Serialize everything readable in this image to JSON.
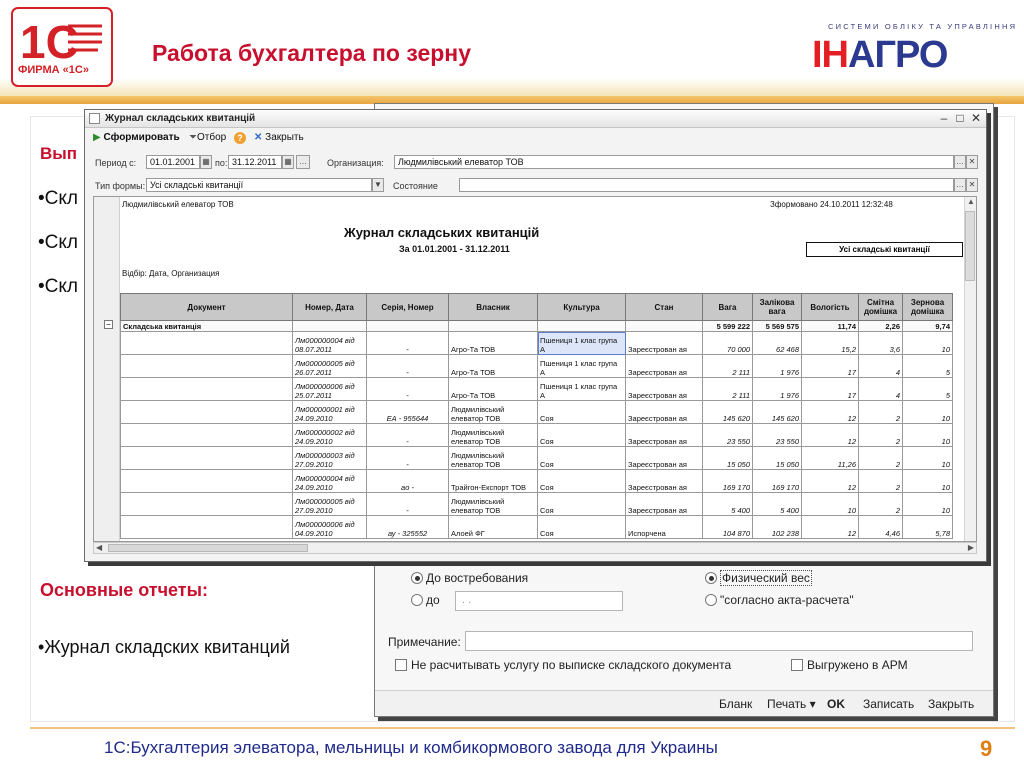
{
  "slide": {
    "title": "Работа бухгалтера по зерну",
    "logo_1c_caption": "ФИРМА «1С»",
    "inagro_tagline": "СИСТЕМИ ОБЛІКУ ТА УПРАВЛІННЯ",
    "inagro_logo_a": "ІН",
    "inagro_logo_b": "АГРО",
    "bullets_partial": [
      "Вып",
      "•Скл",
      "•Скл",
      "•Скл"
    ],
    "reports_heading": "Основные отчеты:",
    "reports_bullet": "•Журнал складских квитанций",
    "footer": "1С:Бухгалтерия элеватора, мельницы и комбикормового завода для Украины",
    "page_number": "9"
  },
  "background_form": {
    "radio_on_demand": "До востребования",
    "radio_until": "до",
    "until_date_placeholder": " .  .",
    "radio_physical_weight": "Физический вес",
    "radio_per_act": "\"согласно акта-расчета\"",
    "note_label": "Примечание:",
    "checkbox_no_service": "Не расчитывать услугу по выписке складского документа",
    "checkbox_uploaded": "Выгружено в АРМ",
    "buttons": {
      "blank": "Бланк",
      "print": "Печать ▾",
      "ok": "OK",
      "save": "Записать",
      "close": "Закрыть"
    }
  },
  "window": {
    "title": "Журнал складських квитанцій",
    "toolbar": {
      "generate": "Сформировать",
      "filter": "Отбор",
      "close": "Закрыть"
    },
    "filters": {
      "period_from_label": "Период с:",
      "period_from": "01.01.2001",
      "period_to_label": "по:",
      "period_to": "31.12.2011",
      "org_label": "Организация:",
      "org_value": "Людмилівський елеватор ТОВ",
      "form_type_label": "Тип формы:",
      "form_type_value": "Усі складські квитанції",
      "state_label": "Состояние",
      "state_value": ""
    }
  },
  "report": {
    "org": "Людмилівський елеватор ТОВ",
    "generated": "Зформовано 24.10.2011 12:32:48",
    "title": "Журнал складських квитанцій",
    "period": "За 01.01.2001 - 31.12.2011",
    "kind_box": "Усі складські квитанції",
    "selection": "Відбір: Дата, Организация",
    "columns": [
      "Документ",
      "Номер, Дата",
      "Серія, Номер",
      "Власник",
      "Культура",
      "Стан",
      "Вага",
      "Залікова вага",
      "Вологість",
      "Смітна домішка",
      "Зернова домішка"
    ],
    "group": {
      "name": "Складська квитанція",
      "weight": "5 599 222",
      "credit_weight": "5 569 575",
      "moisture": "11,74",
      "trash": "2,26",
      "grain": "9,74"
    },
    "rows": [
      {
        "num_date": "Лм000000004 від 08.07.2011",
        "series": "-",
        "owner": "Агро-Та ТОВ",
        "crop": "Пшениця 1 клас група А",
        "state": "Зареєстрован ая",
        "weight": "70 000",
        "credit": "62 468",
        "moist": "15,2",
        "trash": "3,6",
        "grain": "10"
      },
      {
        "num_date": "Лм000000005 від 26.07.2011",
        "series": "-",
        "owner": "Агро-Та ТОВ",
        "crop": "Пшениця 1 клас група А",
        "state": "Зареєстрован ая",
        "weight": "2 111",
        "credit": "1 976",
        "moist": "17",
        "trash": "4",
        "grain": "5"
      },
      {
        "num_date": "Лм000000006 від 25.07.2011",
        "series": "-",
        "owner": "Агро-Та ТОВ",
        "crop": "Пшениця 1 клас група А",
        "state": "Зареєстрован ая",
        "weight": "2 111",
        "credit": "1 976",
        "moist": "17",
        "trash": "4",
        "grain": "5"
      },
      {
        "num_date": "Лм000000001 від 24.09.2010",
        "series": "ЕА - 955644",
        "owner": "Людмилівський елеватор ТОВ",
        "crop": "Соя",
        "state": "Зареєстрован ая",
        "weight": "145 620",
        "credit": "145 620",
        "moist": "12",
        "trash": "2",
        "grain": "10"
      },
      {
        "num_date": "Лм000000002 від 24.09.2010",
        "series": "-",
        "owner": "Людмилівський елеватор ТОВ",
        "crop": "Соя",
        "state": "Зареєстрован ая",
        "weight": "23 550",
        "credit": "23 550",
        "moist": "12",
        "trash": "2",
        "grain": "10"
      },
      {
        "num_date": "Лм000000003 від 27.09.2010",
        "series": "-",
        "owner": "Людмилівський елеватор ТОВ",
        "crop": "Соя",
        "state": "Зареєстрован ая",
        "weight": "15 050",
        "credit": "15 050",
        "moist": "11,26",
        "trash": "2",
        "grain": "10"
      },
      {
        "num_date": "Лм000000004 від 24.09.2010",
        "series": "ао -",
        "owner": "Трайгон-Експорт ТОВ",
        "crop": "Соя",
        "state": "Зареєстрован ая",
        "weight": "169 170",
        "credit": "169 170",
        "moist": "12",
        "trash": "2",
        "grain": "10"
      },
      {
        "num_date": "Лм000000005 від 27.09.2010",
        "series": "-",
        "owner": "Людмилівський елеватор ТОВ",
        "crop": "Соя",
        "state": "Зареєстрован ая",
        "weight": "5 400",
        "credit": "5 400",
        "moist": "10",
        "trash": "2",
        "grain": "10"
      },
      {
        "num_date": "Лм000000006 від 04.09.2010",
        "series": "ау - 325552",
        "owner": "Алоей ФГ",
        "crop": "Соя",
        "state": "Испорчена",
        "weight": "104 870",
        "credit": "102 238",
        "moist": "12",
        "trash": "4,46",
        "grain": "5,78"
      }
    ]
  },
  "colors": {
    "accent_red": "#c8102e",
    "footer_blue": "#1f2a8a",
    "page_num_orange": "#e07f12",
    "inagro_blue": "#2b3990"
  }
}
